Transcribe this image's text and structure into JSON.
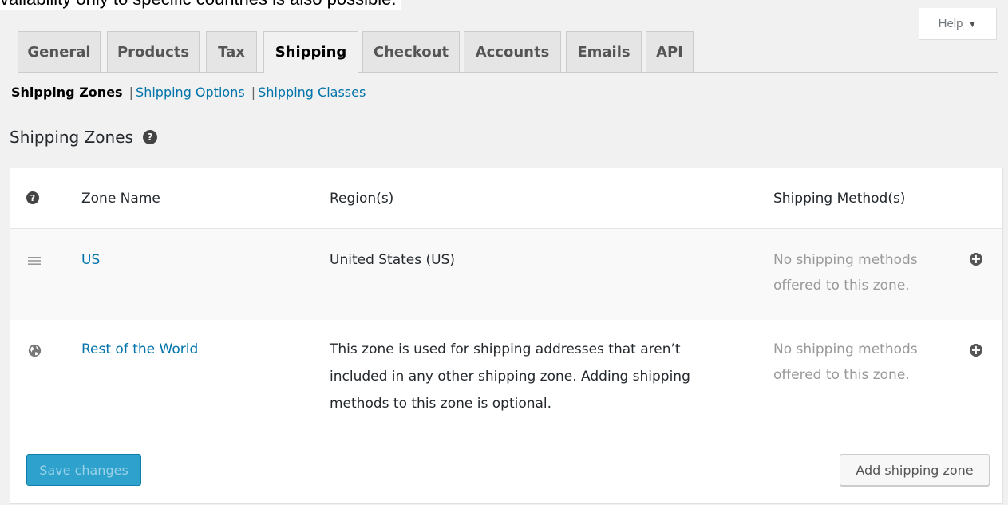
{
  "top_caption": "vailability only to specific countries is also possible.",
  "help": {
    "label": "Help",
    "caret": "▼"
  },
  "tabs": [
    {
      "label": "General"
    },
    {
      "label": "Products"
    },
    {
      "label": "Tax"
    },
    {
      "label": "Shipping",
      "active": true
    },
    {
      "label": "Checkout"
    },
    {
      "label": "Accounts"
    },
    {
      "label": "Emails"
    },
    {
      "label": "API"
    }
  ],
  "subnav": {
    "current": "Shipping Zones",
    "sep": "|",
    "options": "Shipping Options",
    "classes": "Shipping Classes"
  },
  "section": {
    "title": "Shipping Zones",
    "help_icon": "question-circle-icon"
  },
  "table": {
    "headers": {
      "icon": "?",
      "zone": "Zone Name",
      "region": "Region(s)",
      "methods": "Shipping Method(s)"
    },
    "rows": [
      {
        "icon": "drag-handle-icon",
        "zone": "US",
        "region": "United States (US)",
        "methods_line1": "No shipping methods",
        "methods_line2": "offered to this zone."
      },
      {
        "icon": "globe-icon",
        "zone": "Rest of the World",
        "region_line1": "This zone is used for shipping addresses that aren’t",
        "region_line2": "included in any other shipping zone. Adding shipping",
        "region_line3": "methods to this zone is optional.",
        "methods_line1": "No shipping methods",
        "methods_line2": "offered to this zone."
      }
    ]
  },
  "footer": {
    "save": "Save changes",
    "add": "Add shipping zone"
  },
  "colors": {
    "link": "#0073aa",
    "primary_button": "#2ea2cc"
  }
}
